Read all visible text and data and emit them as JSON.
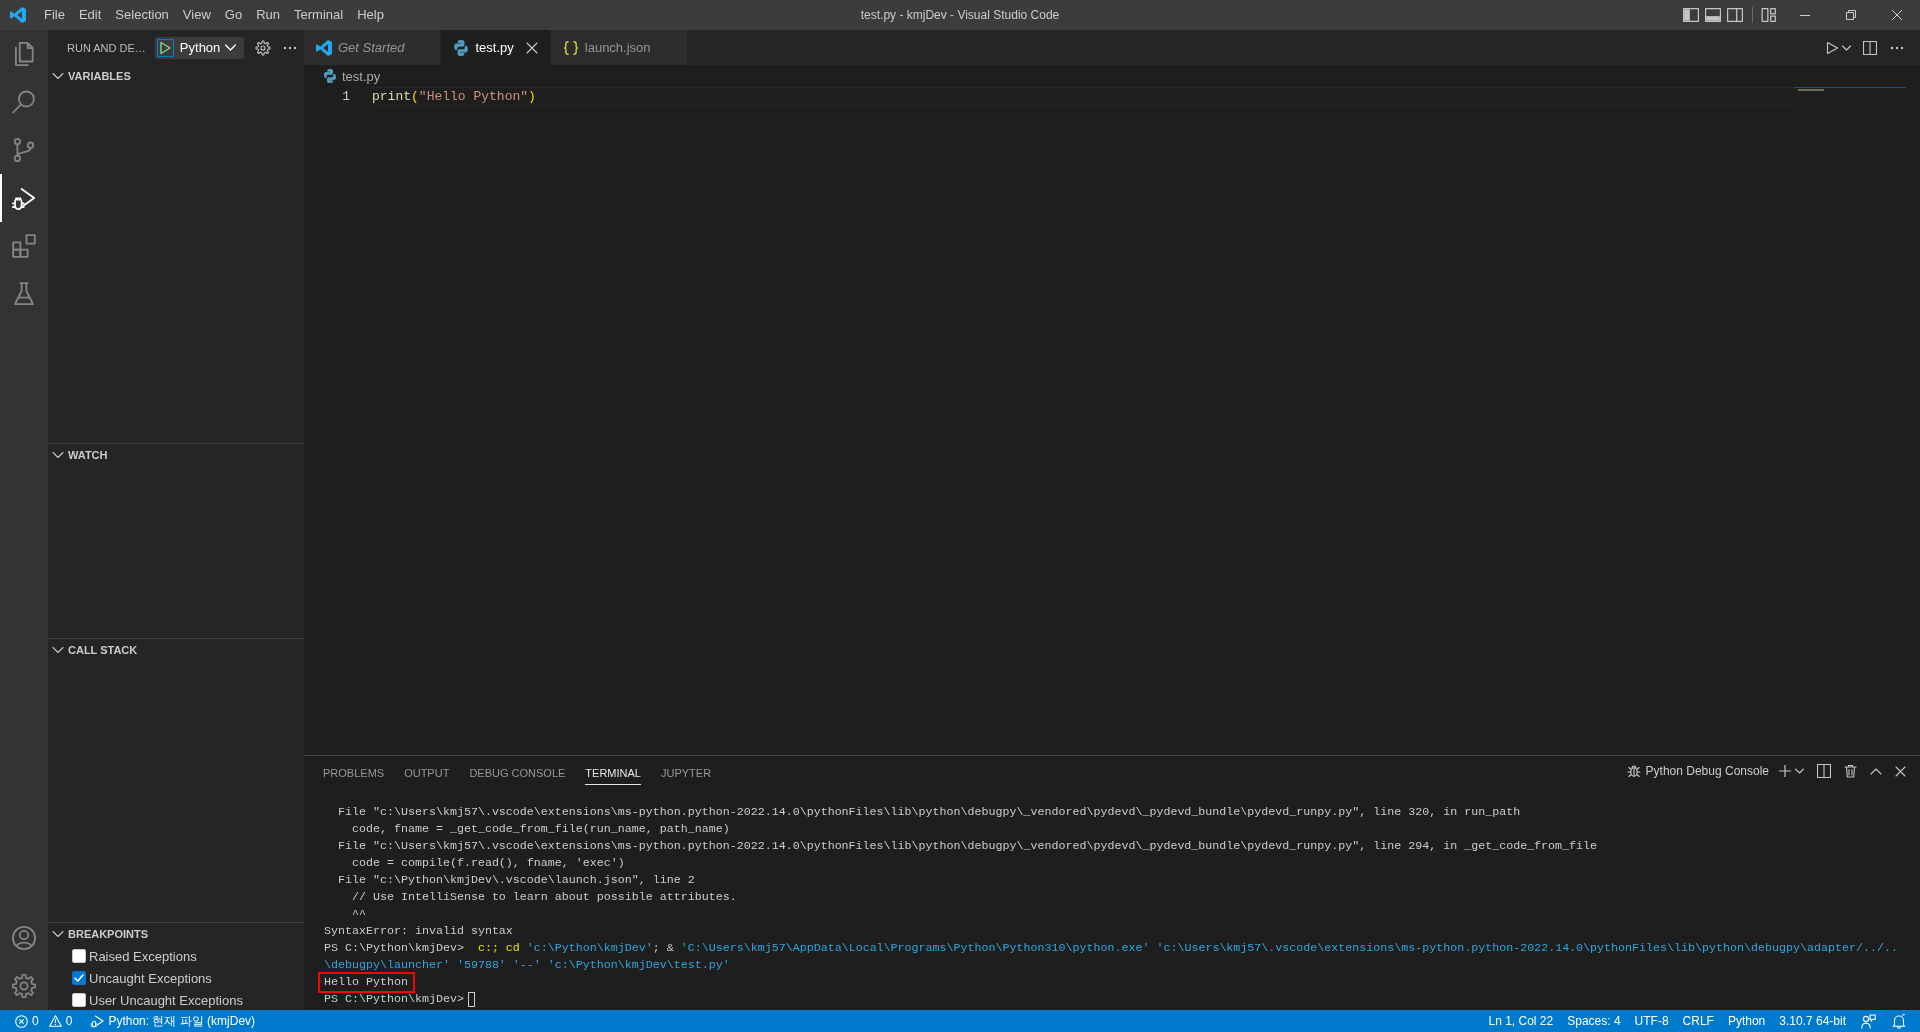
{
  "window": {
    "title": "test.py - kmjDev - Visual Studio Code"
  },
  "menu": [
    "File",
    "Edit",
    "Selection",
    "View",
    "Go",
    "Run",
    "Terminal",
    "Help"
  ],
  "layout": {
    "primary_sidebar": true,
    "panel": true,
    "secondary_sidebar": false
  },
  "activity_bar": {
    "items": [
      {
        "selected": false
      },
      {
        "selected": false
      },
      {
        "selected": false
      },
      {
        "selected": true
      },
      {
        "selected": false
      },
      {
        "selected": false
      }
    ]
  },
  "sidebar": {
    "title": "RUN AND DE…",
    "configuration": "Python",
    "sections": [
      {
        "title": "VARIABLES",
        "expanded": true
      },
      {
        "title": "WATCH",
        "expanded": true
      },
      {
        "title": "CALL STACK",
        "expanded": true
      },
      {
        "title": "BREAKPOINTS",
        "expanded": true,
        "items": [
          {
            "label": "Raised Exceptions",
            "checked": false
          },
          {
            "label": "Uncaught Exceptions",
            "checked": true
          },
          {
            "label": "User Uncaught Exceptions",
            "checked": false
          }
        ]
      }
    ]
  },
  "editor": {
    "tabs": [
      {
        "label": "Get Started",
        "kind": "welcome",
        "preview": true,
        "selected": false
      },
      {
        "label": "test.py",
        "kind": "python",
        "preview": false,
        "selected": true
      },
      {
        "label": "launch.json",
        "kind": "json",
        "preview": false,
        "selected": false
      }
    ],
    "breadcrumb": {
      "file": "test.py",
      "kind": "python"
    },
    "lines": [
      {
        "number": "1",
        "current": true,
        "tokens": [
          {
            "text": "print",
            "kind": "function"
          },
          {
            "text": "(",
            "kind": "bracket"
          },
          {
            "text": "\"Hello Python\"",
            "kind": "string"
          },
          {
            "text": ")",
            "kind": "bracket"
          }
        ]
      }
    ]
  },
  "panel": {
    "tabs": [
      {
        "label": "PROBLEMS",
        "selected": false
      },
      {
        "label": "OUTPUT",
        "selected": false
      },
      {
        "label": "DEBUG CONSOLE",
        "selected": false
      },
      {
        "label": "TERMINAL",
        "selected": true
      },
      {
        "label": "JUPYTER",
        "selected": false
      }
    ],
    "terminal": {
      "name": "Python Debug Console",
      "cursor": true,
      "lines": [
        {
          "highlighted": false,
          "segments": [
            {
              "text": "  File \"c:\\Users\\kmj57\\.vscode\\extensions\\ms-python.python-2022.14.0\\pythonFiles\\lib\\python\\debugpy\\_vendored\\pydevd\\_pydevd_bundle\\pydevd_runpy.py\", line 320, in run_path",
              "kind": "plain"
            }
          ]
        },
        {
          "highlighted": false,
          "segments": [
            {
              "text": "    code, fname = _get_code_from_file(run_name, path_name)",
              "kind": "plain"
            }
          ]
        },
        {
          "highlighted": false,
          "segments": [
            {
              "text": "  File \"c:\\Users\\kmj57\\.vscode\\extensions\\ms-python.python-2022.14.0\\pythonFiles\\lib\\python\\debugpy\\_vendored\\pydevd\\_pydevd_bundle\\pydevd_runpy.py\", line 294, in _get_code_from_file",
              "kind": "plain"
            }
          ]
        },
        {
          "highlighted": false,
          "segments": [
            {
              "text": "    code = compile(f.read(), fname, 'exec')",
              "kind": "plain"
            }
          ]
        },
        {
          "highlighted": false,
          "segments": [
            {
              "text": "  File \"c:\\Python\\kmjDev\\.vscode\\launch.json\", line 2",
              "kind": "plain"
            }
          ]
        },
        {
          "highlighted": false,
          "segments": [
            {
              "text": "    // Use IntelliSense to learn about possible attributes.",
              "kind": "plain"
            }
          ]
        },
        {
          "highlighted": false,
          "segments": [
            {
              "text": "    ^^",
              "kind": "plain"
            }
          ]
        },
        {
          "highlighted": false,
          "segments": [
            {
              "text": "SyntaxError: invalid syntax",
              "kind": "plain"
            }
          ]
        },
        {
          "highlighted": false,
          "segments": [
            {
              "text": "PS C:\\Python\\kmjDev>  ",
              "kind": "plain"
            },
            {
              "text": "c:; cd ",
              "kind": "command"
            },
            {
              "text": "'c:\\Python\\kmjDev'",
              "kind": "string"
            },
            {
              "text": "; & ",
              "kind": "plain"
            },
            {
              "text": "'C:\\Users\\kmj57\\AppData\\Local\\Programs\\Python\\Python310\\python.exe' ",
              "kind": "string"
            },
            {
              "text": "'c:\\Users\\kmj57\\.vscode\\extensions\\ms-python.python-2022.14.0\\pythonFiles\\lib\\python\\debugpy\\adapter/../..",
              "kind": "string"
            }
          ]
        },
        {
          "highlighted": false,
          "segments": [
            {
              "text": "\\debugpy\\launcher' '59788' '--' 'c:\\Python\\kmjDev\\test.py'",
              "kind": "string"
            }
          ]
        },
        {
          "highlighted": true,
          "segments": [
            {
              "text": "Hello Python",
              "kind": "plain"
            }
          ]
        },
        {
          "highlighted": false,
          "segments": [
            {
              "text": "PS C:\\Python\\kmjDev> ",
              "kind": "plain"
            }
          ]
        }
      ]
    }
  },
  "status_bar": {
    "errors": "0",
    "warnings": "0",
    "debug_configuration": "Python: 현재 파일 (kmjDev)",
    "items": [
      "Ln 1, Col 22",
      "Spaces: 4",
      "UTF-8",
      "CRLF",
      "Python",
      "3.10.7 64-bit"
    ]
  }
}
